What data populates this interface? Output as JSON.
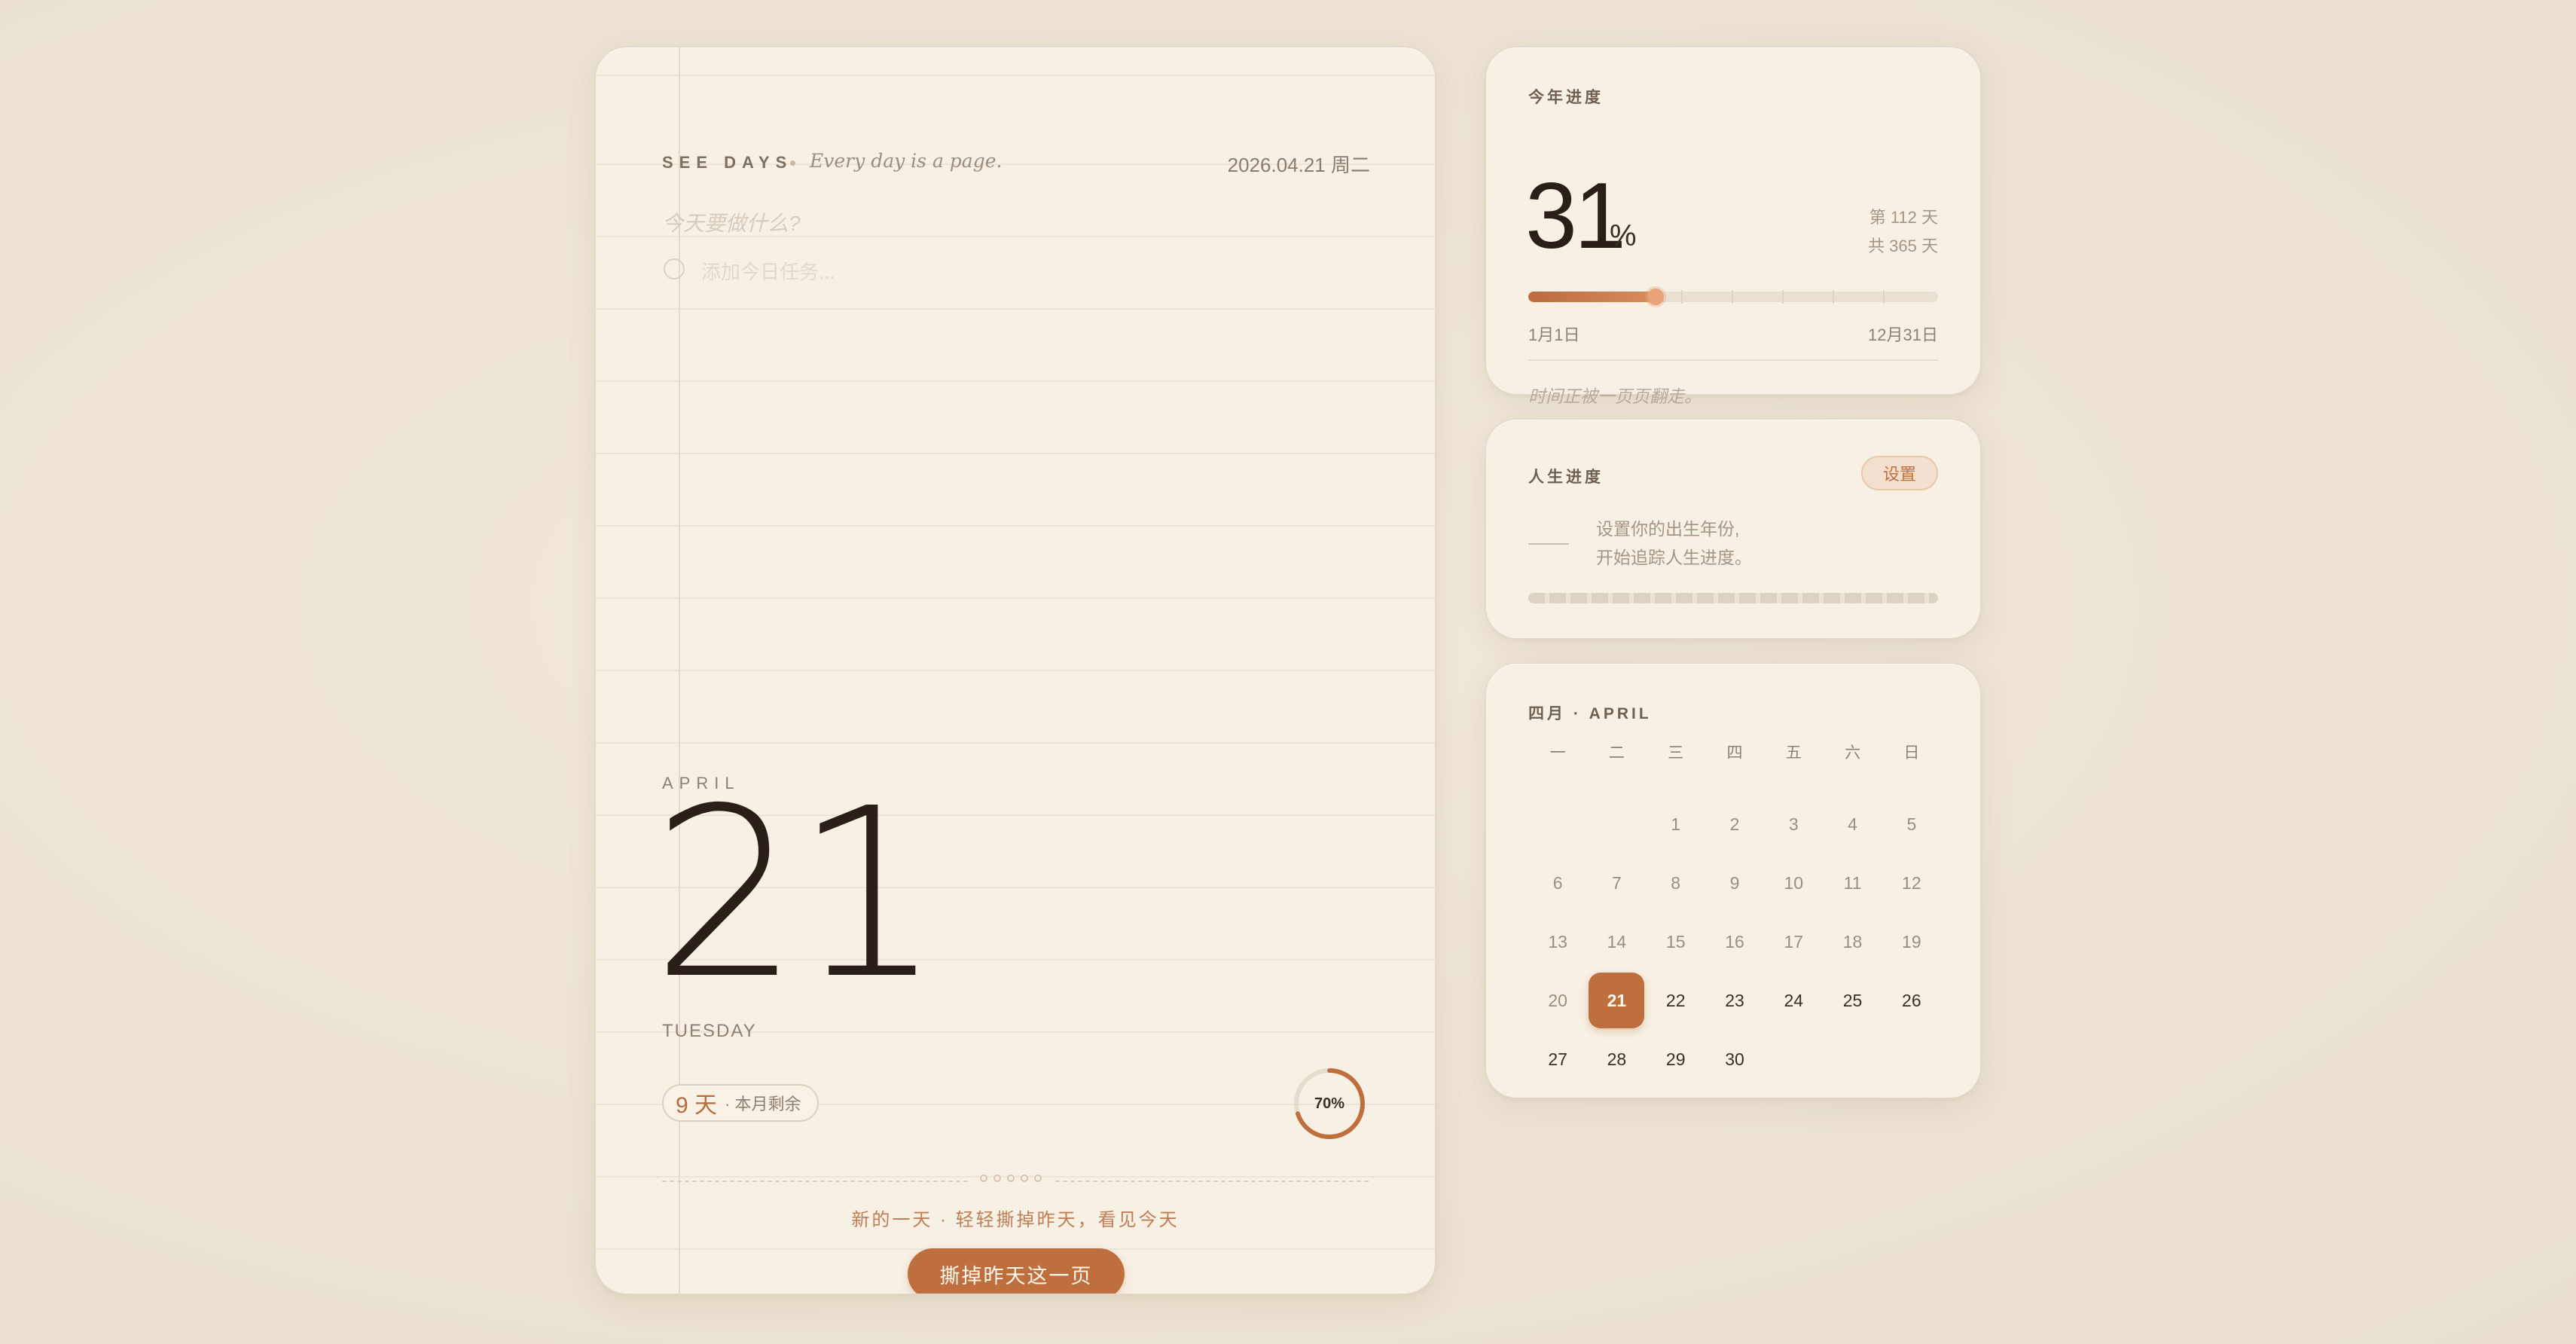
{
  "page": {
    "brand": "SEE DAYS",
    "tagline": "Every day is a page.",
    "date": "2026.04.21 周二",
    "todo_question": "今天要做什么?",
    "todo_placeholder": "添加今日任务...",
    "month": "APRIL",
    "day": "21",
    "weekday": "TUESDAY",
    "remaining_days": "9 天",
    "remaining_label": "· 本月剩余",
    "month_progress_label": "70%",
    "month_progress_fraction": 0.7,
    "motto": "新的一天 · 轻轻撕掉昨天，看见今天",
    "tear_button": "撕掉昨天这一页"
  },
  "year_progress": {
    "title": "今年进度",
    "percent": "31",
    "percent_sign": "%",
    "fraction": 0.31,
    "day_of_year": "第 112 天",
    "total_days": "共 365 天",
    "start_label": "1月1日",
    "end_label": "12月31日",
    "quote": "时间正被一页页翻走。"
  },
  "life_progress": {
    "title": "人生进度",
    "settings_button": "设置",
    "hint_line1": "设置你的出生年份,",
    "hint_line2": "开始追踪人生进度。"
  },
  "calendar": {
    "title": "四月 · APRIL",
    "weekday_headers": [
      "一",
      "二",
      "三",
      "四",
      "五",
      "六",
      "日"
    ],
    "leading_blanks": 2,
    "days": [
      "1",
      "2",
      "3",
      "4",
      "5",
      "6",
      "7",
      "8",
      "9",
      "10",
      "11",
      "12",
      "13",
      "14",
      "15",
      "16",
      "17",
      "18",
      "19",
      "20",
      "21",
      "22",
      "23",
      "24",
      "25",
      "26",
      "27",
      "28",
      "29",
      "30"
    ],
    "today": "21"
  },
  "colors": {
    "accent": "#bf6f3e",
    "background": "#ece3d4",
    "card": "#f7f0e4",
    "text_dark": "#2a1f18"
  }
}
